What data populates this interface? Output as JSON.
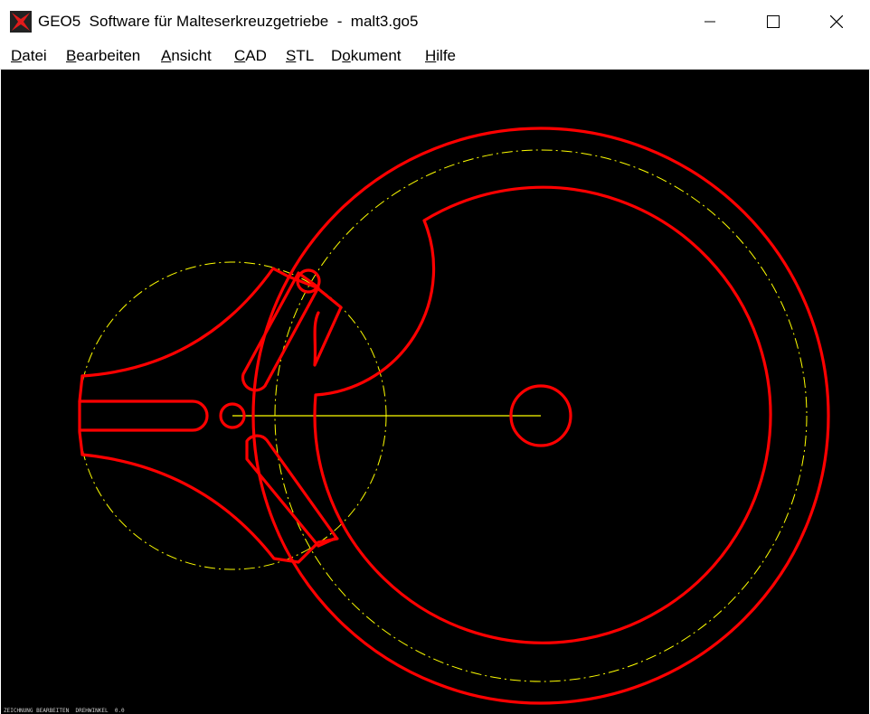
{
  "window": {
    "title": "GEO5  Software für Malteserkreuzgetriebe  -  malt3.go5",
    "icon": "maltese-cross-app-icon",
    "controls": [
      "minimize",
      "maximize",
      "close"
    ]
  },
  "menu": {
    "items": [
      {
        "pre": "",
        "accel": "D",
        "post": "atei"
      },
      {
        "pre": "",
        "accel": "B",
        "post": "earbeiten"
      },
      {
        "pre": "",
        "accel": "A",
        "post": "nsicht"
      },
      {
        "pre": "",
        "accel": "C",
        "post": "AD"
      },
      {
        "pre": "",
        "accel": "S",
        "post": "TL"
      },
      {
        "pre": "D",
        "accel": "o",
        "post": "kument"
      },
      {
        "pre": "",
        "accel": "H",
        "post": "ilfe"
      }
    ]
  },
  "drawing": {
    "background": "#000000",
    "profile_color": "#ff0000",
    "pitch_color": "#ffff00",
    "centerline_color": "#ffff00"
  },
  "status": {
    "text": "ZEICHNUNG BEARBEITEN  DREHWINKEL  0.0"
  }
}
